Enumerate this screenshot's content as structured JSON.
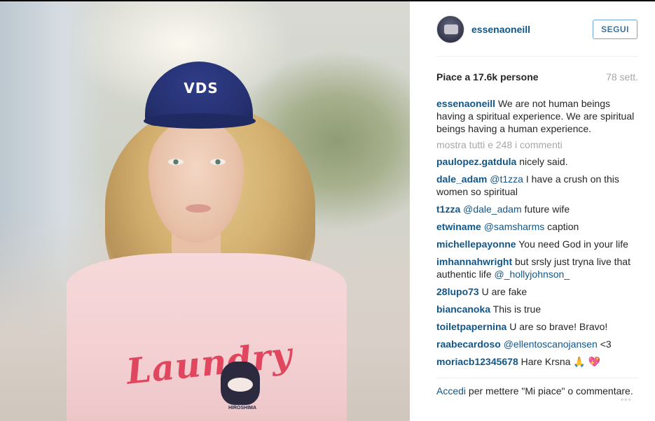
{
  "header": {
    "username": "essenaoneill",
    "follow_label": "SEGUI"
  },
  "stats": {
    "likes": "Piace a 17.6k persone",
    "age": "78 sett."
  },
  "caption": {
    "user": "essenaoneill",
    "text": "We are not human beings having a spiritual experience. We are spiritual beings having a human experience."
  },
  "view_all_comments": "mostra tutti e 248 i commenti",
  "comments": [
    {
      "user": "paulopez.gatdula",
      "mention": "",
      "text": "nicely said."
    },
    {
      "user": "dale_adam",
      "mention": "@t1zza",
      "text": "I have a crush on this women so spiritual"
    },
    {
      "user": "t1zza",
      "mention": "@dale_adam",
      "text": "future wife"
    },
    {
      "user": "etwiname",
      "mention": "@samsharms",
      "text": "caption"
    },
    {
      "user": "michellepayonne",
      "mention": "",
      "text": "You need God in your life"
    },
    {
      "user": "imhannahwright",
      "mention": "",
      "text": "but srsly just tryna live that authentic life",
      "trailing_mention": "@_hollyjohnson_"
    },
    {
      "user": "28lupo73",
      "mention": "",
      "text": "U are fake"
    },
    {
      "user": "biancanoka",
      "mention": "",
      "text": "This is true"
    },
    {
      "user": "toiletpapernina",
      "mention": "",
      "text": "U are so brave! Bravo!"
    },
    {
      "user": "raabecardoso",
      "mention": "@ellentoscanojansen",
      "text": "<3"
    },
    {
      "user": "moriacb12345678",
      "mention": "",
      "text": "Hare Krsna 🙏 💖"
    }
  ],
  "footer": {
    "login_link": "Accedi",
    "login_text": "per mettere \"Mi piace\" o commentare."
  },
  "photo": {
    "cap_logo": "VDS",
    "shirt_text": "Laundry",
    "mascot_label": "HIROSHIMA"
  },
  "icons": {
    "more": "more-options-icon"
  },
  "colors": {
    "link_blue": "#125688",
    "button_blue": "#3f729b",
    "muted_gray": "#a5a7aa"
  }
}
